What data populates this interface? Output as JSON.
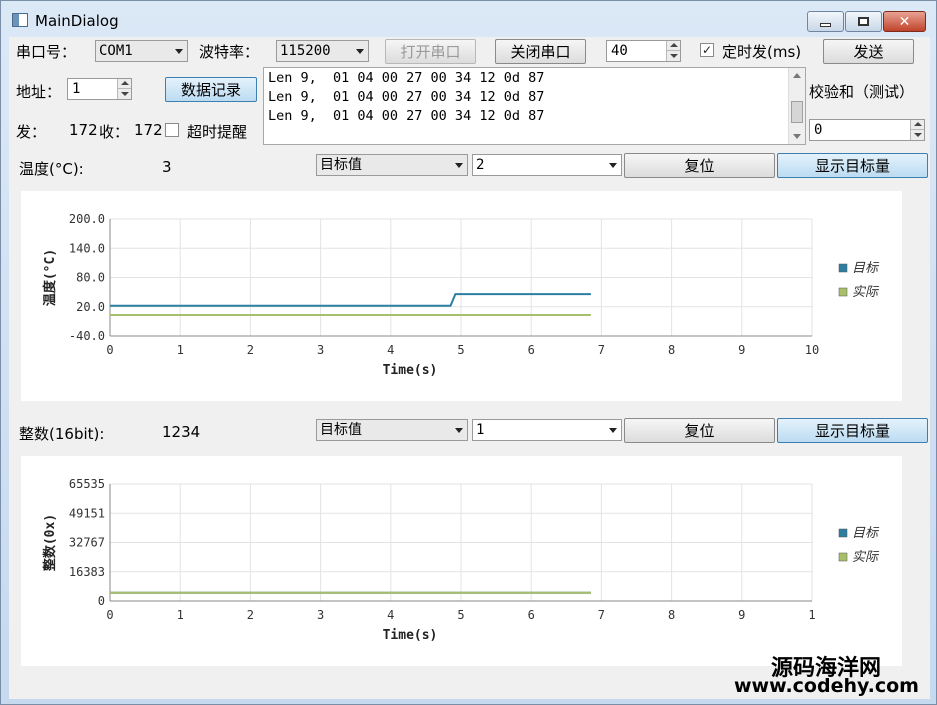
{
  "window": {
    "title": "MainDialog",
    "close_glyph": "✕"
  },
  "serial": {
    "port_label": "串口号：",
    "port_value": "COM1",
    "baud_label": "波特率：",
    "baud_value": "115200",
    "open_button": "打开串口",
    "close_button": "关闭串口",
    "interval_value": "40",
    "timer_label": "定时发(ms)",
    "timer_checked": "✓",
    "send_button": "发送"
  },
  "address": {
    "label": "地址：",
    "value": "1",
    "record_button": "数据记录"
  },
  "counters": {
    "sent_label": "发：",
    "sent_value": "172",
    "recv_label": "收：",
    "recv_value": "172",
    "timeout_label": "超时提醒"
  },
  "log": {
    "lines": [
      "Len 9,  01 04 00 27 00 34 12 0d 87",
      "Len 9,  01 04 00 27 00 34 12 0d 87",
      "Len 9,  01 04 00 27 00 34 12 0d 87"
    ]
  },
  "checksum": {
    "label": "校验和（测试）",
    "value": "0"
  },
  "temp_section": {
    "label": "温度(°C):",
    "value": "3",
    "mode_value": "目标值",
    "input_value": "2",
    "reset_button": "复位",
    "show_target_button": "显示目标量"
  },
  "int_section": {
    "label": "整数(16bit):",
    "value": "1234",
    "mode_value": "目标值",
    "input_value": "1",
    "reset_button": "复位",
    "show_target_button": "显示目标量"
  },
  "chart_data": [
    {
      "type": "line",
      "ylabel": "温度(°C)",
      "xlabel": "Time(s)",
      "xlim": [
        0,
        10
      ],
      "ylim": [
        -40,
        200
      ],
      "x_ticks": [
        "0",
        "1",
        "2",
        "3",
        "4",
        "5",
        "6",
        "7",
        "8",
        "9",
        "10"
      ],
      "y_ticks": [
        "200.0",
        "140.0",
        "80.0",
        "20.0",
        "-40.0"
      ],
      "y_tick_values": [
        200,
        140,
        80,
        20,
        -40
      ],
      "grid": true,
      "legend": "right",
      "series": [
        {
          "name": "目标",
          "color": "#2c7fa0",
          "x": [
            0,
            4.85,
            4.92,
            6.85
          ],
          "y": [
            22,
            22,
            46,
            46
          ]
        },
        {
          "name": "实际",
          "color": "#a8bf6a",
          "x": [
            0,
            6.85
          ],
          "y": [
            3,
            3
          ]
        }
      ]
    },
    {
      "type": "line",
      "ylabel": "整数(0x)",
      "xlabel": "Time(s)",
      "xlim": [
        0,
        10
      ],
      "ylim": [
        0,
        65535
      ],
      "x_ticks": [
        "0",
        "1",
        "2",
        "3",
        "4",
        "5",
        "6",
        "7",
        "8",
        "9",
        "1"
      ],
      "y_ticks": [
        "65535",
        "49151",
        "32767",
        "16383",
        "0"
      ],
      "y_tick_values": [
        65535,
        49151,
        32767,
        16383,
        0
      ],
      "grid": true,
      "legend": "right",
      "series": [
        {
          "name": "目标",
          "color": "#2c7fa0",
          "x": [
            0,
            6.85
          ],
          "y": [
            4660,
            4660
          ]
        },
        {
          "name": "实际",
          "color": "#a8bf6a",
          "x": [
            0,
            6.85
          ],
          "y": [
            4660,
            4660
          ]
        }
      ]
    }
  ],
  "watermark": {
    "cn": "源码海洋网",
    "url": "www.codehy.com"
  }
}
